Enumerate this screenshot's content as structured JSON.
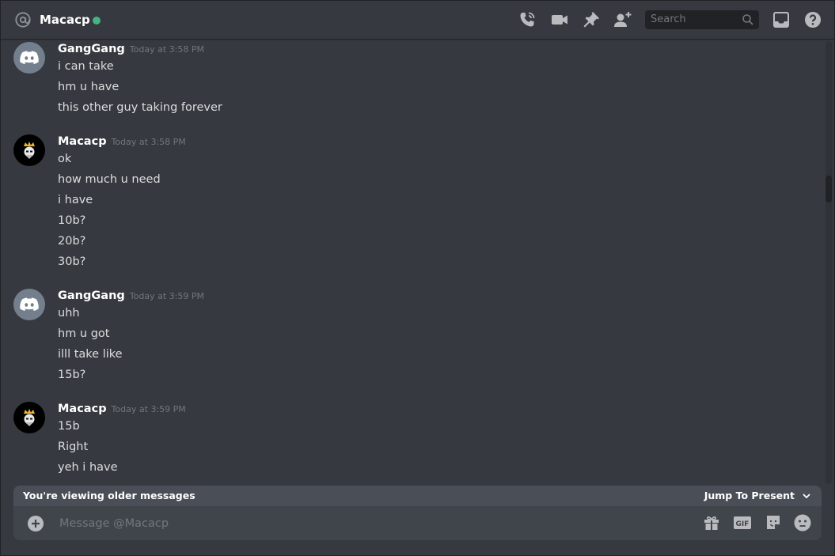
{
  "header": {
    "title": "Macacp",
    "status_color": "#43b581",
    "icons": [
      "at-icon",
      "call-icon",
      "video-icon",
      "pin-icon",
      "add-friend-icon",
      "inbox-icon",
      "help-icon"
    ],
    "search_placeholder": "Search"
  },
  "messages": [
    {
      "author": "GangGang",
      "timestamp": "Today at 3:58 PM",
      "avatar": "discord-logo",
      "lines": [
        "i can take",
        "hm u have",
        "this other guy taking forever"
      ]
    },
    {
      "author": "Macacp",
      "timestamp": "Today at 3:58 PM",
      "avatar": "king-avatar",
      "lines": [
        "ok",
        "how much u need",
        "i have",
        "10b?",
        "20b?",
        "30b?"
      ]
    },
    {
      "author": "GangGang",
      "timestamp": "Today at 3:59 PM",
      "avatar": "discord-logo",
      "lines": [
        "uhh",
        "hm u got",
        "illl take like",
        "15b?"
      ]
    },
    {
      "author": "Macacp",
      "timestamp": "Today at 3:59 PM",
      "avatar": "king-avatar",
      "lines": [
        "15b",
        "Right",
        "yeh i have"
      ]
    }
  ],
  "older_bar": {
    "text": "You're viewing older messages",
    "jump_label": "Jump To Present"
  },
  "composer": {
    "placeholder": "Message @Macacp",
    "icons": [
      "plus-icon",
      "gift-icon",
      "gif-icon",
      "sticker-icon",
      "emoji-icon"
    ]
  },
  "colors": {
    "background": "#36393f",
    "accent_online": "#43b581"
  }
}
